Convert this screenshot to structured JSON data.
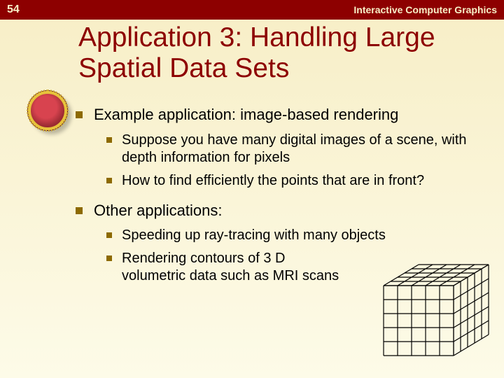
{
  "header": {
    "slide_number": "54",
    "course": "Interactive Computer Graphics"
  },
  "title": "Application 3: Handling Large Spatial Data Sets",
  "bullets": [
    {
      "text": "Example application: image-based rendering",
      "sub": [
        "Suppose you have many digital images of a scene, with depth information for pixels",
        "How to find efficiently the points that are in front?"
      ]
    },
    {
      "text": "Other applications:",
      "sub": [
        "Speeding up ray-tracing with many objects",
        "Rendering contours of 3 D volumetric data such as MRI scans"
      ]
    }
  ],
  "figure": {
    "alt": "5x5x5 wireframe cube grid"
  }
}
